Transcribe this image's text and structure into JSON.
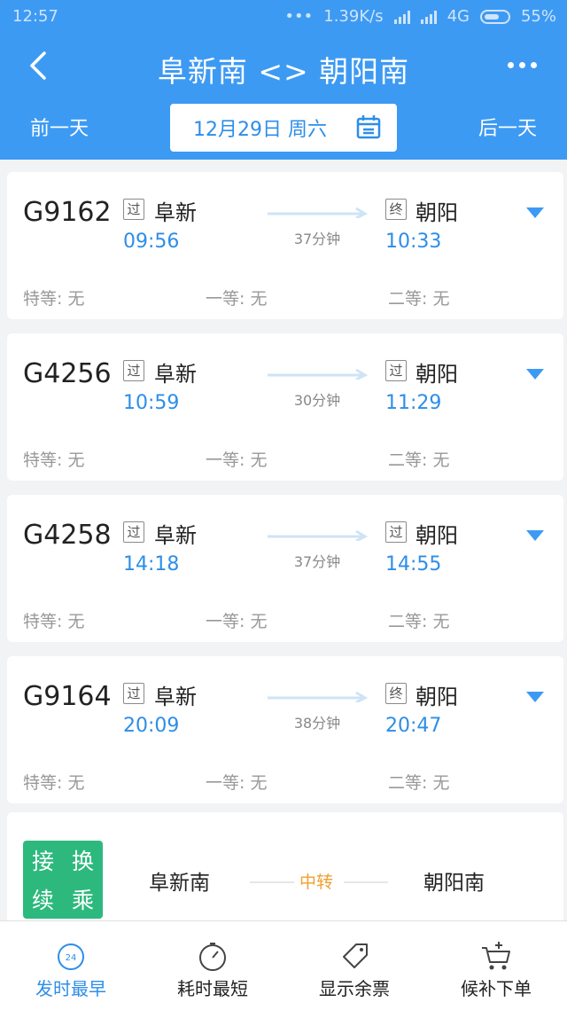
{
  "status_bar": {
    "time": "12:57",
    "dots": "•••",
    "speed": "1.39K/s",
    "network": "4G",
    "battery": "55%"
  },
  "header": {
    "title": "阜新南 <> 朝阳南",
    "prev_day": "前一天",
    "date": "12月29日 周六",
    "next_day": "后一天"
  },
  "trains": [
    {
      "no": "G9162",
      "from_badge": "过",
      "from": "阜新",
      "dep": "09:56",
      "to_badge": "终",
      "to": "朝阳",
      "arr": "10:33",
      "duration": "37分钟",
      "seats": [
        "特等: 无",
        "一等: 无",
        "二等: 无"
      ]
    },
    {
      "no": "G4256",
      "from_badge": "过",
      "from": "阜新",
      "dep": "10:59",
      "to_badge": "过",
      "to": "朝阳",
      "arr": "11:29",
      "duration": "30分钟",
      "seats": [
        "特等: 无",
        "一等: 无",
        "二等: 无"
      ]
    },
    {
      "no": "G4258",
      "from_badge": "过",
      "from": "阜新",
      "dep": "14:18",
      "to_badge": "过",
      "to": "朝阳",
      "arr": "14:55",
      "duration": "37分钟",
      "seats": [
        "特等: 无",
        "一等: 无",
        "二等: 无"
      ]
    },
    {
      "no": "G9164",
      "from_badge": "过",
      "from": "阜新",
      "dep": "20:09",
      "to_badge": "终",
      "to": "朝阳",
      "arr": "20:47",
      "duration": "38分钟",
      "seats": [
        "特等: 无",
        "一等: 无",
        "二等: 无"
      ]
    }
  ],
  "transfer": {
    "badge": [
      "接",
      "换",
      "续",
      "乘"
    ],
    "from": "阜新南",
    "middle": "中转",
    "to": "朝阳南"
  },
  "bottom_nav": [
    {
      "label": "发时最早",
      "icon": "clock-24-icon",
      "active": true,
      "badge": "24"
    },
    {
      "label": "耗时最短",
      "icon": "timer-icon",
      "active": false
    },
    {
      "label": "显示余票",
      "icon": "ticket-tag-icon",
      "active": false
    },
    {
      "label": "候补下单",
      "icon": "cart-plus-icon",
      "active": false
    }
  ],
  "colors": {
    "header_bg": "#3d9af3",
    "accent": "#2d8ee8",
    "transfer_green": "#2db97d",
    "transfer_mid": "#f0a030"
  }
}
